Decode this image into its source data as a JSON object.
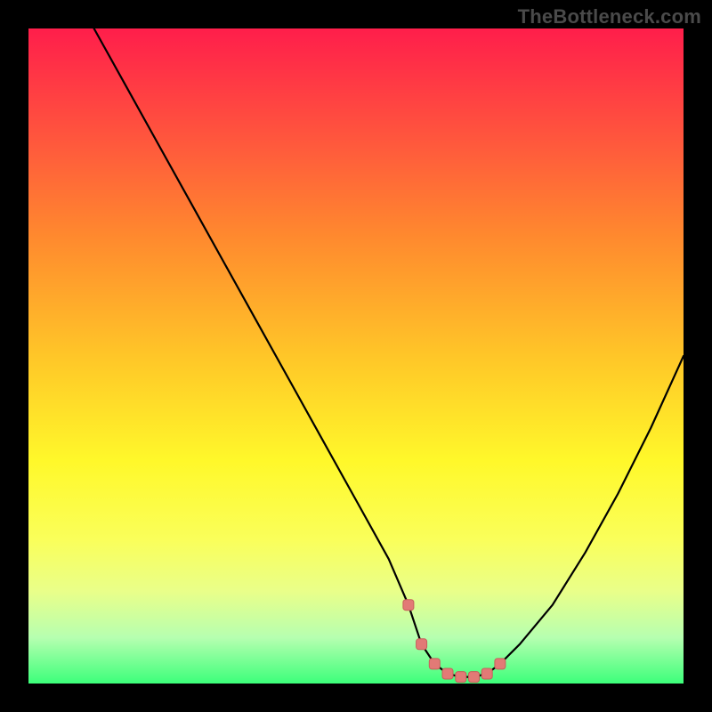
{
  "watermark": "TheBottleneck.com",
  "colors": {
    "curve_stroke": "#000000",
    "marker_fill": "#e27a76",
    "marker_stroke": "#c85f5b"
  },
  "chart_data": {
    "type": "line",
    "title": "",
    "xlabel": "",
    "ylabel": "",
    "xlim": [
      0,
      100
    ],
    "ylim": [
      0,
      100
    ],
    "series": [
      {
        "name": "bottleneck-curve",
        "x": [
          10,
          15,
          20,
          25,
          30,
          35,
          40,
          45,
          50,
          55,
          58,
          60,
          62,
          64,
          66,
          68,
          70,
          72,
          75,
          80,
          85,
          90,
          95,
          100
        ],
        "values": [
          100,
          91,
          82,
          73,
          64,
          55,
          46,
          37,
          28,
          19,
          12,
          6,
          3,
          1.5,
          1,
          1,
          1.5,
          3,
          6,
          12,
          20,
          29,
          39,
          50
        ]
      }
    ],
    "markers": {
      "name": "highlight-range",
      "x": [
        58,
        60,
        62,
        64,
        66,
        68,
        70,
        72
      ],
      "values": [
        12,
        6,
        3,
        1.5,
        1,
        1,
        1.5,
        3
      ]
    }
  }
}
